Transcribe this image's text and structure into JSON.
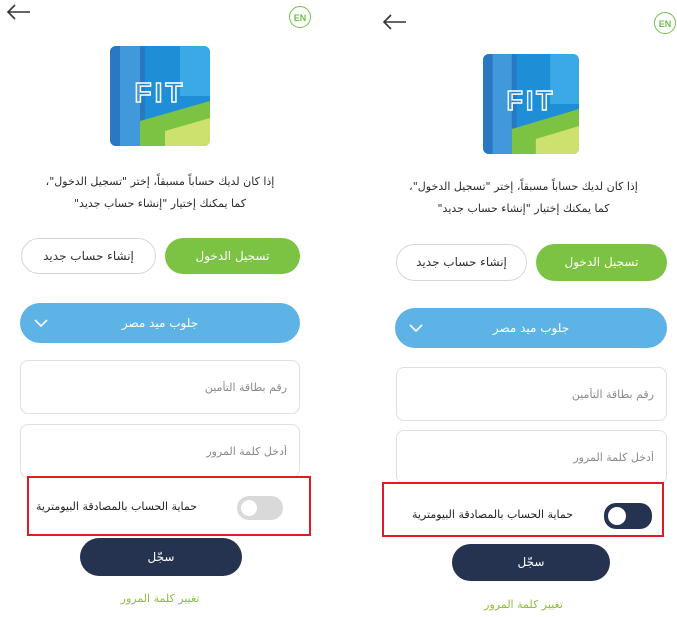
{
  "screens": [
    {
      "id": "left",
      "lang_label": "EN",
      "logo_text": "FIT",
      "intro_line1": "إذا كان لديك حساباً مسبقاً، إختر \"تسجيل الدخول\"،",
      "intro_line2": "كما يمكنك إختيار \"إنشاء حساب جديد\"",
      "login_label": "تسجيل الدخول",
      "create_label": "إنشاء حساب جديد",
      "company_label": "جلوب ميد مصر",
      "insurance_placeholder": "رقم بطاقة التأمين",
      "password_placeholder": "أدخل كلمة المرور",
      "biometric_label": "حماية الحساب بالمصادقة البيومترية",
      "biometric_enabled": false,
      "register_label": "سجّل",
      "change_password_label": "تغيير كلمة المرور"
    },
    {
      "id": "right",
      "lang_label": "EN",
      "logo_text": "FIT",
      "intro_line1": "إذا كان لديك حساباً مسبقاً، إختر \"تسجيل الدخول\"،",
      "intro_line2": "كما يمكنك إختيار \"إنشاء حساب جديد\"",
      "login_label": "تسجيل الدخول",
      "create_label": "إنشاء حساب جديد",
      "company_label": "جلوب ميد مصر",
      "insurance_placeholder": "رقم بطاقة التأمين",
      "password_placeholder": "أدخل كلمة المرور",
      "biometric_label": "حماية الحساب بالمصادقة البيومترية",
      "biometric_enabled": true,
      "register_label": "سجّل",
      "change_password_label": "تغيير كلمة المرور"
    }
  ],
  "colors": {
    "green": "#7cc243",
    "blue": "#5db3e6",
    "navy": "#263350",
    "highlight_red": "#e11b22",
    "toggle_off": "#d9d9d9",
    "toggle_on": "#263350"
  },
  "icons": {
    "back": "back-arrow-icon",
    "dropdown": "chevron-down-icon"
  }
}
